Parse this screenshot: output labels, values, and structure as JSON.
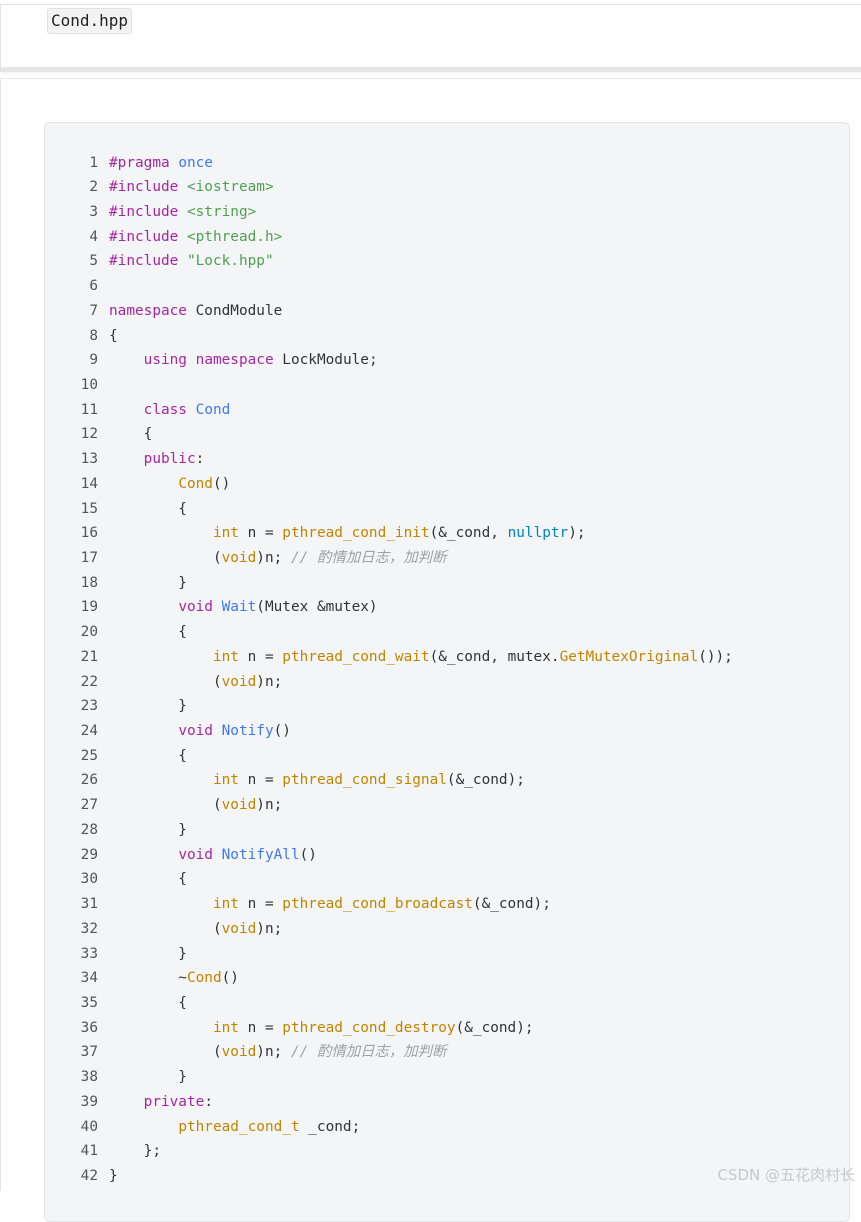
{
  "file": {
    "name": "Cond.hpp"
  },
  "code": {
    "lines": [
      {
        "n": "1",
        "tokens": [
          {
            "t": "#pragma ",
            "c": "kw"
          },
          {
            "t": "once",
            "c": "ns"
          }
        ]
      },
      {
        "n": "2",
        "tokens": [
          {
            "t": "#include ",
            "c": "kw"
          },
          {
            "t": "<iostream>",
            "c": "str"
          }
        ]
      },
      {
        "n": "3",
        "tokens": [
          {
            "t": "#include ",
            "c": "kw"
          },
          {
            "t": "<string>",
            "c": "str"
          }
        ]
      },
      {
        "n": "4",
        "tokens": [
          {
            "t": "#include ",
            "c": "kw"
          },
          {
            "t": "<pthread.h>",
            "c": "str"
          }
        ]
      },
      {
        "n": "5",
        "tokens": [
          {
            "t": "#include ",
            "c": "kw"
          },
          {
            "t": "\"Lock.hpp\"",
            "c": "str"
          }
        ]
      },
      {
        "n": "6",
        "tokens": []
      },
      {
        "n": "7",
        "tokens": [
          {
            "t": "namespace",
            "c": "kw"
          },
          {
            "t": " CondModule",
            "c": "pl"
          }
        ]
      },
      {
        "n": "8",
        "tokens": [
          {
            "t": "{",
            "c": "pl"
          }
        ]
      },
      {
        "n": "9",
        "tokens": [
          {
            "t": "    ",
            "c": "pl"
          },
          {
            "t": "using",
            "c": "kw"
          },
          {
            "t": " ",
            "c": "pl"
          },
          {
            "t": "namespace",
            "c": "kw"
          },
          {
            "t": " LockModule;",
            "c": "pl"
          }
        ]
      },
      {
        "n": "10",
        "tokens": []
      },
      {
        "n": "11",
        "tokens": [
          {
            "t": "    ",
            "c": "pl"
          },
          {
            "t": "class",
            "c": "kw"
          },
          {
            "t": " ",
            "c": "pl"
          },
          {
            "t": "Cond",
            "c": "fn"
          }
        ]
      },
      {
        "n": "12",
        "tokens": [
          {
            "t": "    {",
            "c": "pl"
          }
        ]
      },
      {
        "n": "13",
        "tokens": [
          {
            "t": "    ",
            "c": "pl"
          },
          {
            "t": "public",
            "c": "kw"
          },
          {
            "t": ":",
            "c": "pl"
          }
        ]
      },
      {
        "n": "14",
        "tokens": [
          {
            "t": "        ",
            "c": "pl"
          },
          {
            "t": "Cond",
            "c": "call"
          },
          {
            "t": "()",
            "c": "pl"
          }
        ]
      },
      {
        "n": "15",
        "tokens": [
          {
            "t": "        {",
            "c": "pl"
          }
        ]
      },
      {
        "n": "16",
        "tokens": [
          {
            "t": "            ",
            "c": "pl"
          },
          {
            "t": "int",
            "c": "tp"
          },
          {
            "t": " n = ",
            "c": "pl"
          },
          {
            "t": "pthread_cond_init",
            "c": "call"
          },
          {
            "t": "(&_cond, ",
            "c": "pl"
          },
          {
            "t": "nullptr",
            "c": "nullptr"
          },
          {
            "t": ");",
            "c": "pl"
          }
        ]
      },
      {
        "n": "17",
        "tokens": [
          {
            "t": "            (",
            "c": "pl"
          },
          {
            "t": "void",
            "c": "tp"
          },
          {
            "t": ")n; ",
            "c": "pl"
          },
          {
            "t": "// 酌情加日志，加判断",
            "c": "cm"
          }
        ]
      },
      {
        "n": "18",
        "tokens": [
          {
            "t": "        }",
            "c": "pl"
          }
        ]
      },
      {
        "n": "19",
        "tokens": [
          {
            "t": "        ",
            "c": "pl"
          },
          {
            "t": "void",
            "c": "kw"
          },
          {
            "t": " ",
            "c": "pl"
          },
          {
            "t": "Wait",
            "c": "fn"
          },
          {
            "t": "(Mutex &mutex)",
            "c": "pl"
          }
        ]
      },
      {
        "n": "20",
        "tokens": [
          {
            "t": "        {",
            "c": "pl"
          }
        ]
      },
      {
        "n": "21",
        "tokens": [
          {
            "t": "            ",
            "c": "pl"
          },
          {
            "t": "int",
            "c": "tp"
          },
          {
            "t": " n = ",
            "c": "pl"
          },
          {
            "t": "pthread_cond_wait",
            "c": "call"
          },
          {
            "t": "(&_cond, mutex.",
            "c": "pl"
          },
          {
            "t": "GetMutexOriginal",
            "c": "call"
          },
          {
            "t": "());",
            "c": "pl"
          }
        ]
      },
      {
        "n": "22",
        "tokens": [
          {
            "t": "            (",
            "c": "pl"
          },
          {
            "t": "void",
            "c": "tp"
          },
          {
            "t": ")n;",
            "c": "pl"
          }
        ]
      },
      {
        "n": "23",
        "tokens": [
          {
            "t": "        }",
            "c": "pl"
          }
        ]
      },
      {
        "n": "24",
        "tokens": [
          {
            "t": "        ",
            "c": "pl"
          },
          {
            "t": "void",
            "c": "kw"
          },
          {
            "t": " ",
            "c": "pl"
          },
          {
            "t": "Notify",
            "c": "fn"
          },
          {
            "t": "()",
            "c": "pl"
          }
        ]
      },
      {
        "n": "25",
        "tokens": [
          {
            "t": "        {",
            "c": "pl"
          }
        ]
      },
      {
        "n": "26",
        "tokens": [
          {
            "t": "            ",
            "c": "pl"
          },
          {
            "t": "int",
            "c": "tp"
          },
          {
            "t": " n = ",
            "c": "pl"
          },
          {
            "t": "pthread_cond_signal",
            "c": "call"
          },
          {
            "t": "(&_cond);",
            "c": "pl"
          }
        ]
      },
      {
        "n": "27",
        "tokens": [
          {
            "t": "            (",
            "c": "pl"
          },
          {
            "t": "void",
            "c": "tp"
          },
          {
            "t": ")n;",
            "c": "pl"
          }
        ]
      },
      {
        "n": "28",
        "tokens": [
          {
            "t": "        }",
            "c": "pl"
          }
        ]
      },
      {
        "n": "29",
        "tokens": [
          {
            "t": "        ",
            "c": "pl"
          },
          {
            "t": "void",
            "c": "kw"
          },
          {
            "t": " ",
            "c": "pl"
          },
          {
            "t": "NotifyAll",
            "c": "fn"
          },
          {
            "t": "()",
            "c": "pl"
          }
        ]
      },
      {
        "n": "30",
        "tokens": [
          {
            "t": "        {",
            "c": "pl"
          }
        ]
      },
      {
        "n": "31",
        "tokens": [
          {
            "t": "            ",
            "c": "pl"
          },
          {
            "t": "int",
            "c": "tp"
          },
          {
            "t": " n = ",
            "c": "pl"
          },
          {
            "t": "pthread_cond_broadcast",
            "c": "call"
          },
          {
            "t": "(&_cond);",
            "c": "pl"
          }
        ]
      },
      {
        "n": "32",
        "tokens": [
          {
            "t": "            (",
            "c": "pl"
          },
          {
            "t": "void",
            "c": "tp"
          },
          {
            "t": ")n;",
            "c": "pl"
          }
        ]
      },
      {
        "n": "33",
        "tokens": [
          {
            "t": "        }",
            "c": "pl"
          }
        ]
      },
      {
        "n": "34",
        "tokens": [
          {
            "t": "        ~",
            "c": "pl"
          },
          {
            "t": "Cond",
            "c": "call"
          },
          {
            "t": "()",
            "c": "pl"
          }
        ]
      },
      {
        "n": "35",
        "tokens": [
          {
            "t": "        {",
            "c": "pl"
          }
        ]
      },
      {
        "n": "36",
        "tokens": [
          {
            "t": "            ",
            "c": "pl"
          },
          {
            "t": "int",
            "c": "tp"
          },
          {
            "t": " n = ",
            "c": "pl"
          },
          {
            "t": "pthread_cond_destroy",
            "c": "call"
          },
          {
            "t": "(&_cond);",
            "c": "pl"
          }
        ]
      },
      {
        "n": "37",
        "tokens": [
          {
            "t": "            (",
            "c": "pl"
          },
          {
            "t": "void",
            "c": "tp"
          },
          {
            "t": ")n; ",
            "c": "pl"
          },
          {
            "t": "// 酌情加日志，加判断",
            "c": "cm"
          }
        ]
      },
      {
        "n": "38",
        "tokens": [
          {
            "t": "        }",
            "c": "pl"
          }
        ]
      },
      {
        "n": "39",
        "tokens": [
          {
            "t": "    ",
            "c": "pl"
          },
          {
            "t": "private",
            "c": "kw"
          },
          {
            "t": ":",
            "c": "pl"
          }
        ]
      },
      {
        "n": "40",
        "tokens": [
          {
            "t": "        ",
            "c": "pl"
          },
          {
            "t": "pthread_cond_t",
            "c": "call"
          },
          {
            "t": " _cond;",
            "c": "pl"
          }
        ]
      },
      {
        "n": "41",
        "tokens": [
          {
            "t": "    };",
            "c": "pl"
          }
        ]
      },
      {
        "n": "42",
        "tokens": [
          {
            "t": "}",
            "c": "pl"
          }
        ]
      }
    ]
  },
  "watermark": "CSDN @五花肉村长"
}
